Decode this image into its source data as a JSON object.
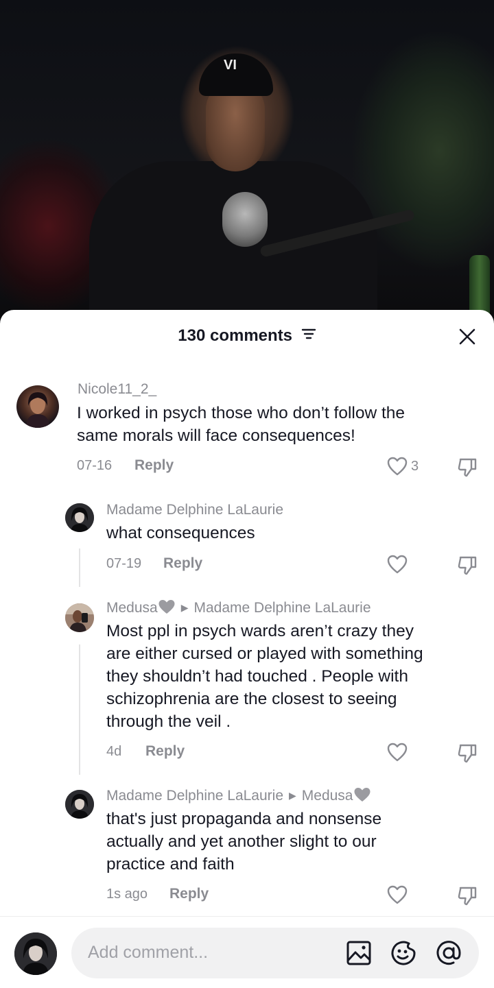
{
  "video": {
    "cap_logo_text": "VI"
  },
  "comments_panel": {
    "title": "130 comments",
    "comments": [
      {
        "username": "Nicole11_2_",
        "text_lines": [
          "I worked in psych those who don’t follow the",
          "same morals will face consequences!"
        ],
        "date": "07-16",
        "reply_label": "Reply",
        "like_count": "3"
      },
      {
        "username": "Madame Delphine LaLaurie",
        "text_lines": [
          "what consequences"
        ],
        "date": "07-19",
        "reply_label": "Reply"
      },
      {
        "username": "Medusa",
        "reply_to": "Madame Delphine LaLaurie",
        "text_lines": [
          "Most ppl in psych wards aren’t crazy they",
          "are either cursed or played with something",
          "they shouldn’t had touched . People with",
          "schizophrenia are the closest to seeing",
          "through the veil ."
        ],
        "date": "4d",
        "reply_label": "Reply"
      },
      {
        "username": "Madame Delphine LaLaurie",
        "reply_to": "Medusa",
        "text_lines": [
          "that's just propaganda and nonsense",
          "actually and yet another slight to our",
          "practice and faith"
        ],
        "date": "1s ago",
        "reply_label": "Reply"
      }
    ]
  },
  "composer": {
    "placeholder": "Add comment..."
  },
  "icons": {
    "filter": "filter-icon",
    "close": "close-icon",
    "like": "heart-icon",
    "dislike": "thumbs-down-icon",
    "image": "image-icon",
    "emoji": "emoji-icon",
    "mention": "at-icon",
    "username_heart": "grey-heart-icon"
  },
  "colors": {
    "text_primary": "#161823",
    "text_secondary": "#8a8b91",
    "input_bg": "#f1f1f2"
  }
}
